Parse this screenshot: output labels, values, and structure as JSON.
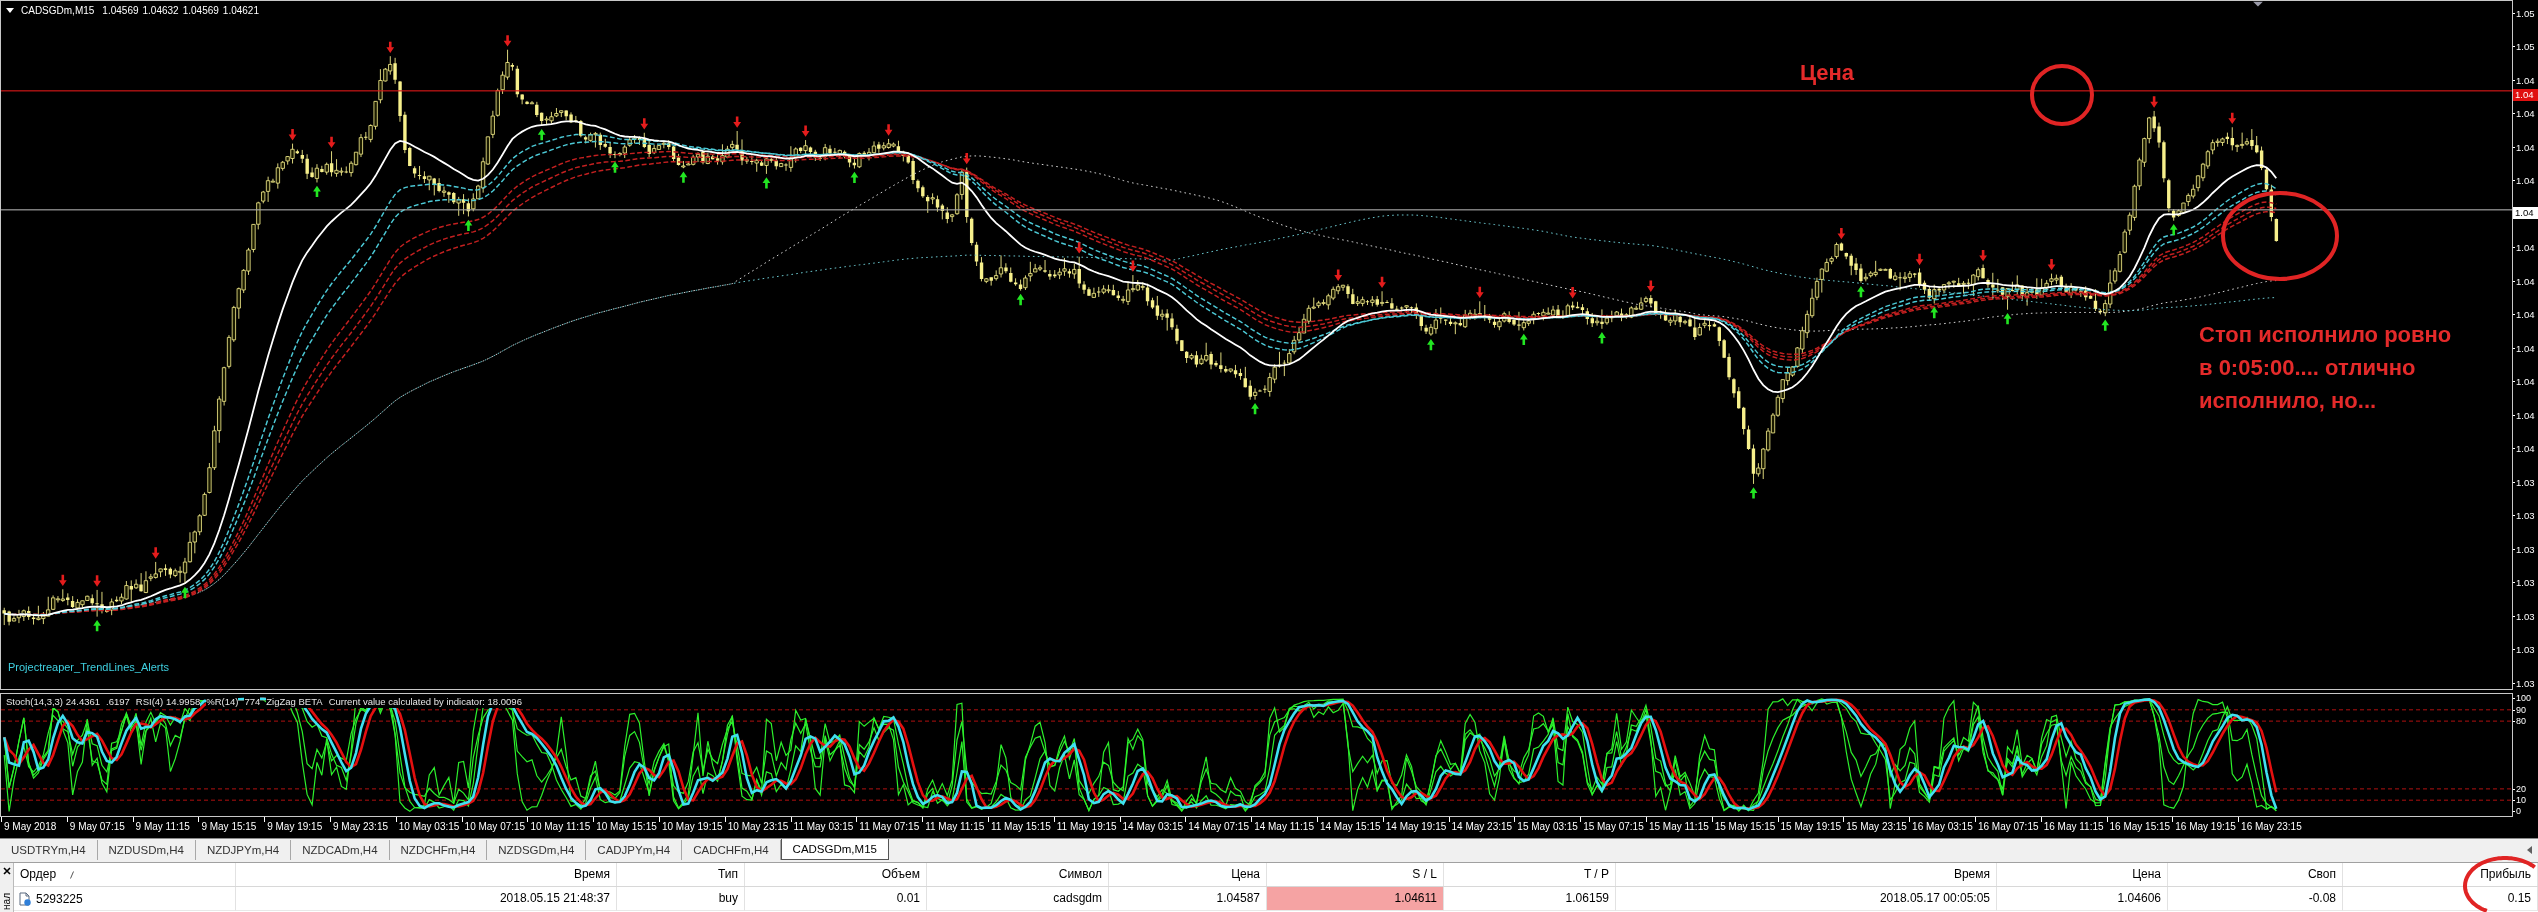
{
  "chart": {
    "symbol": "CADSGDm,M15",
    "ohlc": [
      "1.04569",
      "1.04632",
      "1.04569",
      "1.04621"
    ],
    "indicator_label": "Projectreaper_TrendLines_Alerts",
    "price_axis": [
      "1.05",
      "1.05",
      "1.04",
      "1.04",
      "1.04",
      "1.04",
      "1.04",
      "1.04",
      "1.04",
      "1.04",
      "1.04",
      "1.04",
      "1.04",
      "1.03",
      "1.03",
      "1.03",
      "1.03",
      "1.03",
      "1.03",
      "1.03"
    ],
    "level_marker": "1.04",
    "bid_marker": "1.04"
  },
  "oscillator": {
    "labels": [
      "Stoch(14,3,3) 24.4361",
      ".6197",
      "RSI(4) 14.9958",
      "%R(14)",
      "774",
      "ZigZag BETA",
      "Current value calculated by indicator: 18.0096"
    ],
    "axis": [
      "100",
      "90",
      "80",
      "20",
      "10",
      "0"
    ]
  },
  "time_axis": [
    "9 May 2018",
    "9 May 07:15",
    "9 May 11:15",
    "9 May 15:15",
    "9 May 19:15",
    "9 May 23:15",
    "10 May 03:15",
    "10 May 07:15",
    "10 May 11:15",
    "10 May 15:15",
    "10 May 19:15",
    "10 May 23:15",
    "11 May 03:15",
    "11 May 07:15",
    "11 May 11:15",
    "11 May 15:15",
    "11 May 19:15",
    "14 May 03:15",
    "14 May 07:15",
    "14 May 11:15",
    "14 May 15:15",
    "14 May 19:15",
    "14 May 23:15",
    "15 May 03:15",
    "15 May 07:15",
    "15 May 11:15",
    "15 May 15:15",
    "15 May 19:15",
    "15 May 23:15",
    "16 May 03:15",
    "16 May 07:15",
    "16 May 11:15",
    "16 May 15:15",
    "16 May 19:15",
    "16 May 23:15"
  ],
  "tabs": [
    {
      "label": "USDTRYm,H4",
      "selected": false
    },
    {
      "label": "NZDUSDm,H4",
      "selected": false
    },
    {
      "label": "NZDJPYm,H4",
      "selected": false
    },
    {
      "label": "NZDCADm,H4",
      "selected": false
    },
    {
      "label": "NZDCHFm,H4",
      "selected": false
    },
    {
      "label": "NZDSGDm,H4",
      "selected": false
    },
    {
      "label": "CADJPYm,H4",
      "selected": false
    },
    {
      "label": "CADCHFm,H4",
      "selected": false
    },
    {
      "label": "CADSGDm,M15",
      "selected": true
    }
  ],
  "terminal": {
    "side_label": "нал",
    "columns": [
      "Ордер",
      "Время",
      "Тип",
      "Объем",
      "Символ",
      "Цена",
      "S / L",
      "T / P",
      "Время",
      "Цена",
      "Своп",
      "Прибыль"
    ],
    "rows": [
      {
        "cells": [
          {
            "text": "5293225",
            "highlighted": false
          },
          {
            "text": "2018.05.15 21:48:37",
            "highlighted": false
          },
          {
            "text": "buy",
            "highlighted": false
          },
          {
            "text": "0.01",
            "highlighted": false
          },
          {
            "text": "cadsgdm",
            "highlighted": false
          },
          {
            "text": "1.04587",
            "highlighted": false
          },
          {
            "text": "1.04611",
            "highlighted": true
          },
          {
            "text": "1.06159",
            "highlighted": false
          },
          {
            "text": "2018.05.17 00:05:05",
            "highlighted": false
          },
          {
            "text": "1.04606",
            "highlighted": false
          },
          {
            "text": "-0.08",
            "highlighted": false
          },
          {
            "text": "0.15",
            "highlighted": false
          }
        ]
      }
    ]
  },
  "annotations": [
    {
      "kind": "label",
      "lines": [
        "Цена"
      ]
    },
    {
      "kind": "note",
      "lines": [
        "Стоп исполнило ровно",
        "в 0:05:00.... отлично",
        "исполнило, но..."
      ]
    }
  ]
}
